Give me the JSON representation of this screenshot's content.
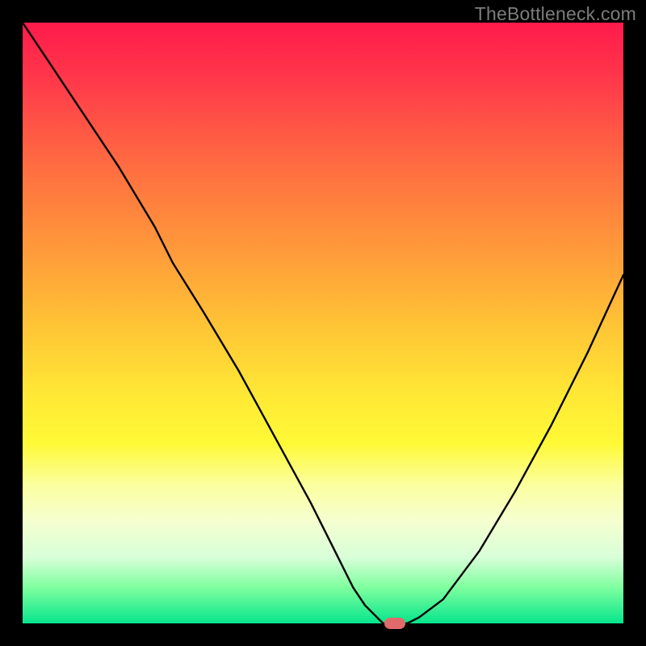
{
  "watermark": "TheBottleneck.com",
  "chart_data": {
    "type": "line",
    "title": "",
    "xlabel": "",
    "ylabel": "",
    "xlim": [
      0,
      100
    ],
    "ylim": [
      0,
      100
    ],
    "grid": false,
    "x": [
      0,
      4,
      10,
      16,
      22,
      25,
      30,
      36,
      42,
      48,
      52,
      55,
      57,
      59,
      60,
      64,
      66,
      70,
      76,
      82,
      88,
      94,
      100
    ],
    "y": [
      100,
      94,
      85,
      76,
      66,
      60,
      52,
      42,
      31,
      20,
      12,
      6,
      3,
      1,
      0,
      0,
      1,
      4,
      12,
      22,
      33,
      45,
      58
    ],
    "marker": {
      "x": 62,
      "y": 0,
      "color": "#e36a6a"
    },
    "background_gradient": {
      "top": "#ff1a4b",
      "mid": "#ffe835",
      "bottom": "#06e58c"
    }
  }
}
